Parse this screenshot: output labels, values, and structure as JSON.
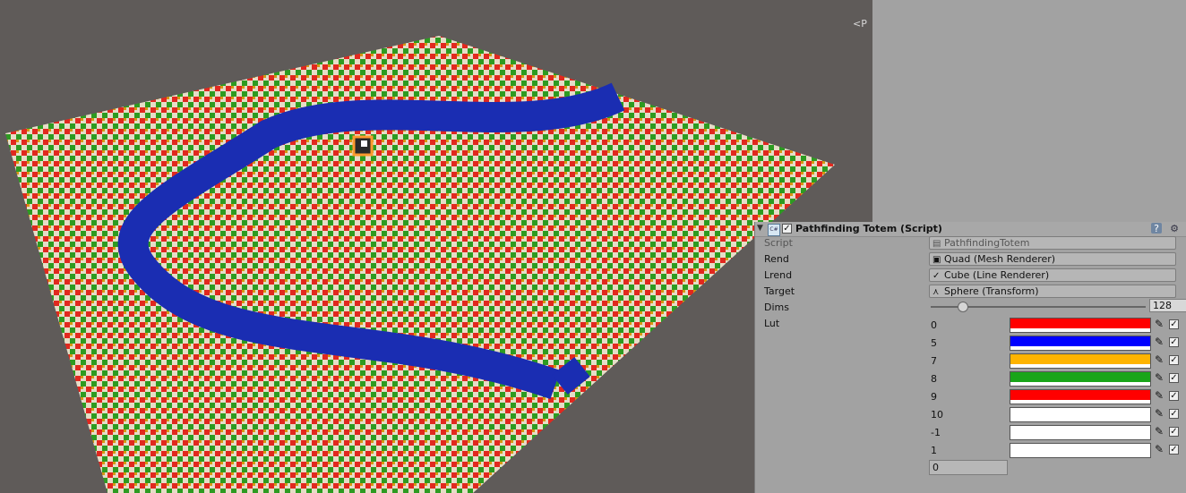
{
  "scene": {
    "view_label": "<P",
    "map_colors": [
      "#e1281f",
      "#e6ddc7",
      "#2d9b21",
      "#d69711",
      "#1a2db2"
    ]
  },
  "inspector": {
    "component_title": "Pathfinding Totem (Script)",
    "script_label": "Script",
    "script_value": "PathfindingTotem",
    "rend_label": "Rend",
    "rend_value": "Quad (Mesh Renderer)",
    "lrend_label": "Lrend",
    "lrend_value": "Cube (Line Renderer)",
    "target_label": "Target",
    "target_value": "Sphere (Transform)",
    "dims_label": "Dims",
    "dims_value": "128",
    "lut_label": "Lut",
    "lut": [
      {
        "key": "0",
        "color": "#ff0000"
      },
      {
        "key": "5",
        "color": "#0000ff"
      },
      {
        "key": "7",
        "color": "#ffb400"
      },
      {
        "key": "8",
        "color": "#19a519"
      },
      {
        "key": "9",
        "color": "#ff0000"
      },
      {
        "key": "10",
        "color": "#ffffff"
      },
      {
        "key": "-1",
        "color": "#ffffff"
      },
      {
        "key": "1",
        "color": "#ffffff"
      }
    ],
    "new_key_value": "0"
  }
}
